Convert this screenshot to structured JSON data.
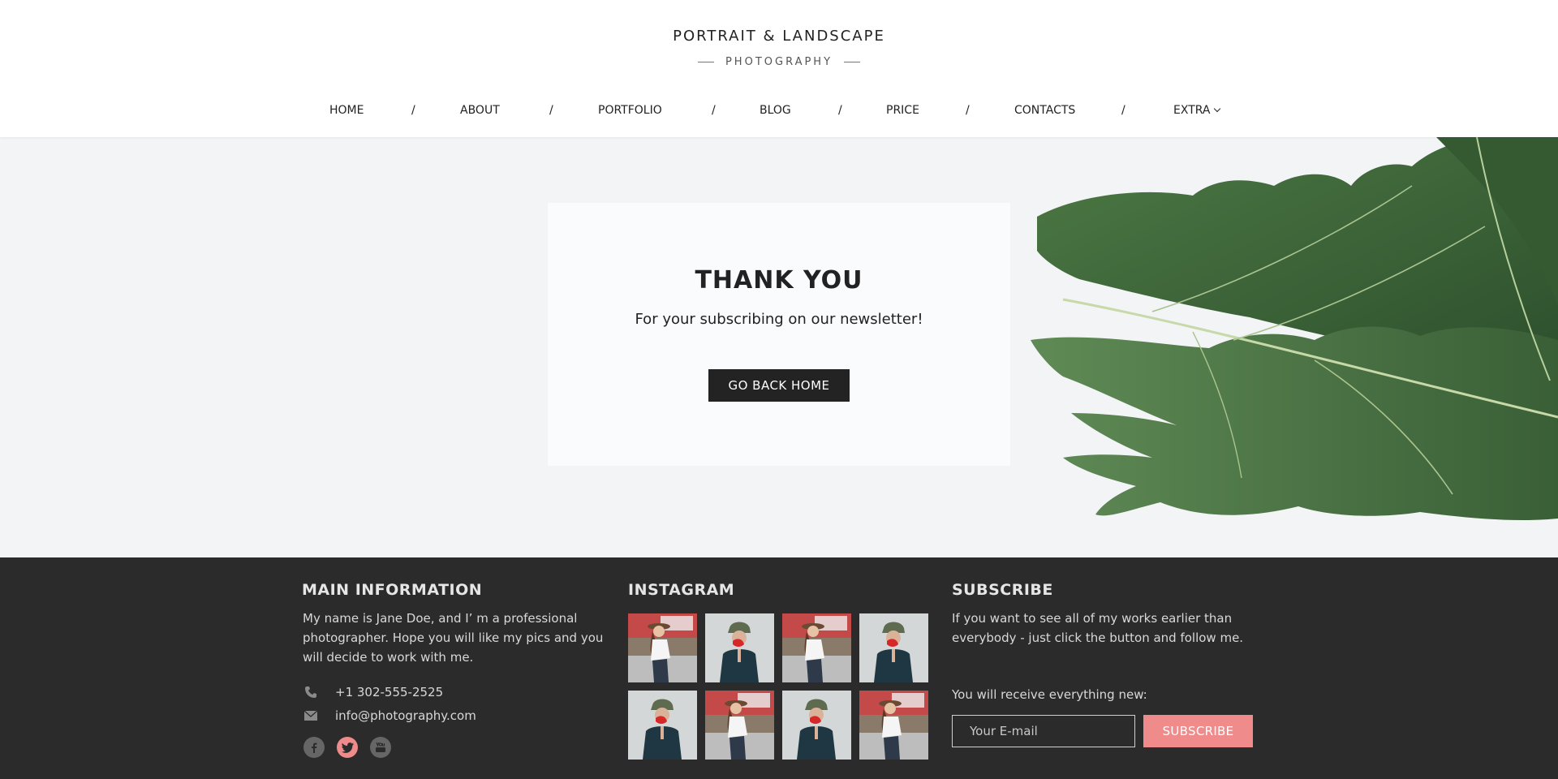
{
  "brand": {
    "title": "PORTRAIT & LANDSCAPE",
    "subtitle": "PHOTOGRAPHY"
  },
  "nav": {
    "items": [
      {
        "label": "HOME"
      },
      {
        "label": "ABOUT"
      },
      {
        "label": "PORTFOLIO"
      },
      {
        "label": "BLOG"
      },
      {
        "label": "PRICE"
      },
      {
        "label": "CONTACTS"
      },
      {
        "label": "EXTRA"
      }
    ],
    "separator": "/"
  },
  "hero": {
    "title": "THANK YOU",
    "text": "For your subscribing on our newsletter!",
    "button_label": "GO BACK HOME"
  },
  "footer": {
    "main_info": {
      "heading": "MAIN INFORMATION",
      "text": "My name is Jane Doe, and I’ m a professional photographer. Hope you will like my pics and you will decide to work with me.",
      "phone": "+1 302-555-2525",
      "email": "info@photography.com",
      "social": [
        "facebook-icon",
        "twitter-icon",
        "youtube-icon"
      ]
    },
    "instagram": {
      "heading": "INSTAGRAM",
      "photos": [
        "woman-hat",
        "man-cap-flower",
        "woman-hat",
        "man-cap-flower",
        "man-cap-flower",
        "woman-hat",
        "man-cap-flower",
        "woman-hat"
      ]
    },
    "subscribe": {
      "heading": "SUBSCRIBE",
      "text": "If you want to see all of my works earlier than everybody - just click the button and follow me.",
      "note": "You will receive everything new:",
      "input_placeholder": "Your E-mail",
      "button_label": "SUBSCRIBE"
    }
  },
  "colors": {
    "accent": "#f08b8b",
    "footer_bg": "#2b2b2b",
    "hero_bg": "#f3f4f6",
    "dark_button": "#232323"
  }
}
